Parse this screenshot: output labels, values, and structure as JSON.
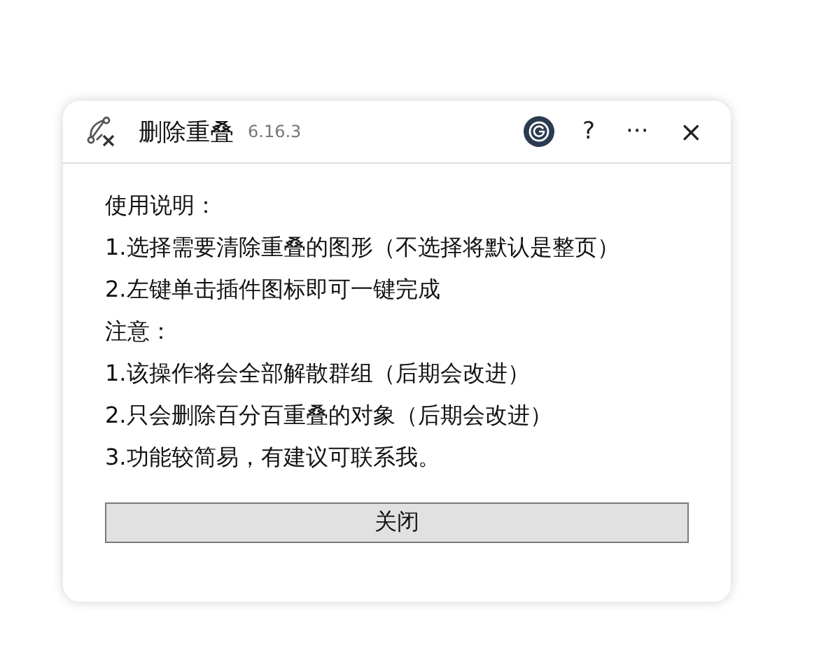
{
  "window": {
    "title": "删除重叠",
    "version": "6.16.3",
    "controls": [
      {
        "kind": "account"
      },
      {
        "kind": "help",
        "label": "?"
      },
      {
        "kind": "more",
        "label": "···"
      },
      {
        "kind": "close",
        "label": "×"
      }
    ]
  },
  "lines": [
    "使用说明：",
    "1.选择需要清除重叠的图形（不选择将默认是整页）",
    "2.左键单击插件图标即可一键完成",
    "注意：",
    "1.该操作将会全部解散群组（后期会改进）",
    "2.只会删除百分百重叠的对象（后期会改进）",
    "3.功能较简易，有建议可联系我。"
  ],
  "buttons": [
    "关闭"
  ]
}
